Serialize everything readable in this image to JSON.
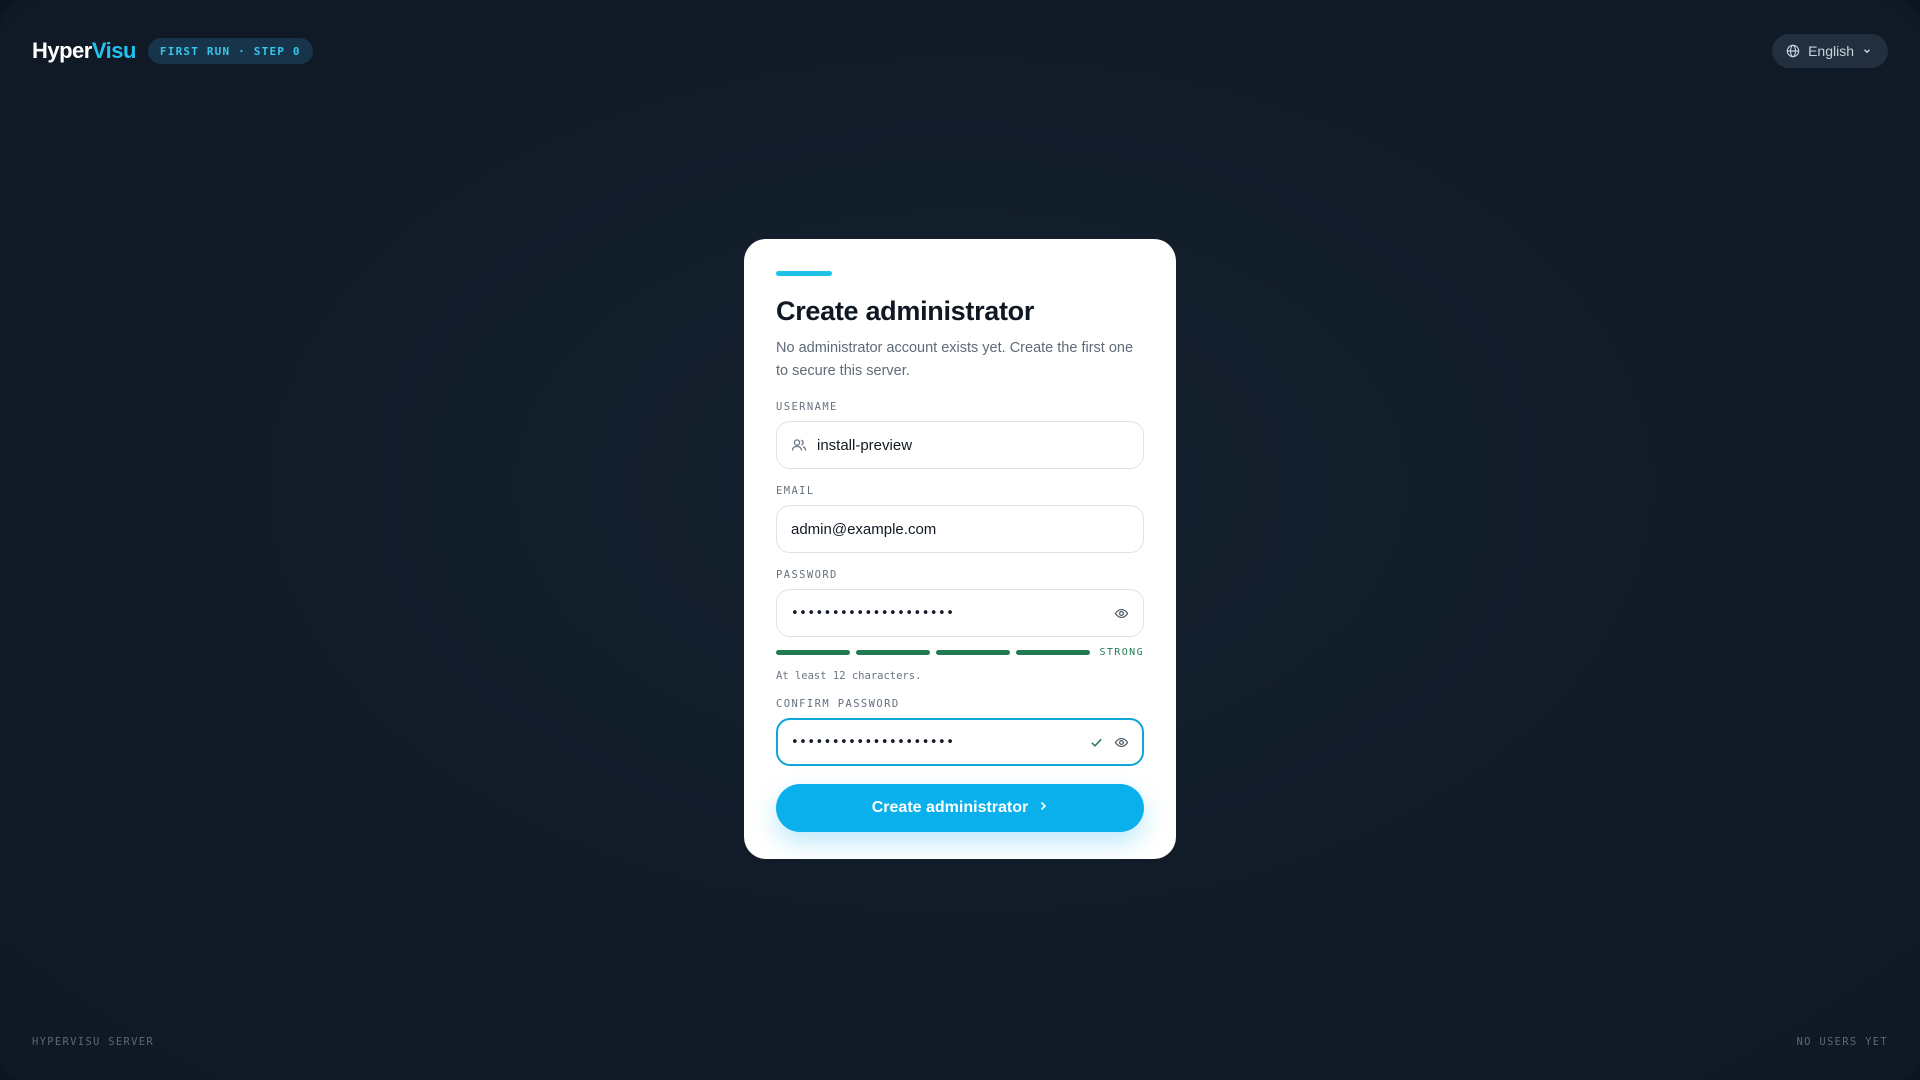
{
  "header": {
    "logo_primary": "Hyper",
    "logo_accent": "Visu",
    "step_badge": "FIRST RUN · STEP 0",
    "language": "English"
  },
  "card": {
    "title": "Create administrator",
    "subtitle": "No administrator account exists yet. Create the first one to secure this server.",
    "username": {
      "label": "USERNAME",
      "value": "install-preview"
    },
    "email": {
      "label": "EMAIL",
      "value": "admin@example.com"
    },
    "password": {
      "label": "PASSWORD",
      "value": "••••••••••••••••••••",
      "strength_label": "STRONG",
      "strength_segments_filled": 4,
      "strength_segments_total": 4,
      "hint": "At least 12 characters."
    },
    "confirm_password": {
      "label": "CONFIRM PASSWORD",
      "value": "••••••••••••••••••••",
      "match": true
    },
    "submit_label": "Create administrator"
  },
  "footer": {
    "left": "HYPERVISU SERVER",
    "right": "NO USERS YET"
  },
  "colors": {
    "accent": "#22c1ee",
    "button": "#0ab0ec",
    "strength": "#1f7a52",
    "background": "#111b28"
  },
  "icons": {
    "language": "globe-icon",
    "language_caret": "chevron-down-icon",
    "username": "users-icon",
    "reveal": "eye-icon",
    "match": "check-icon",
    "submit": "chevron-right-icon"
  }
}
